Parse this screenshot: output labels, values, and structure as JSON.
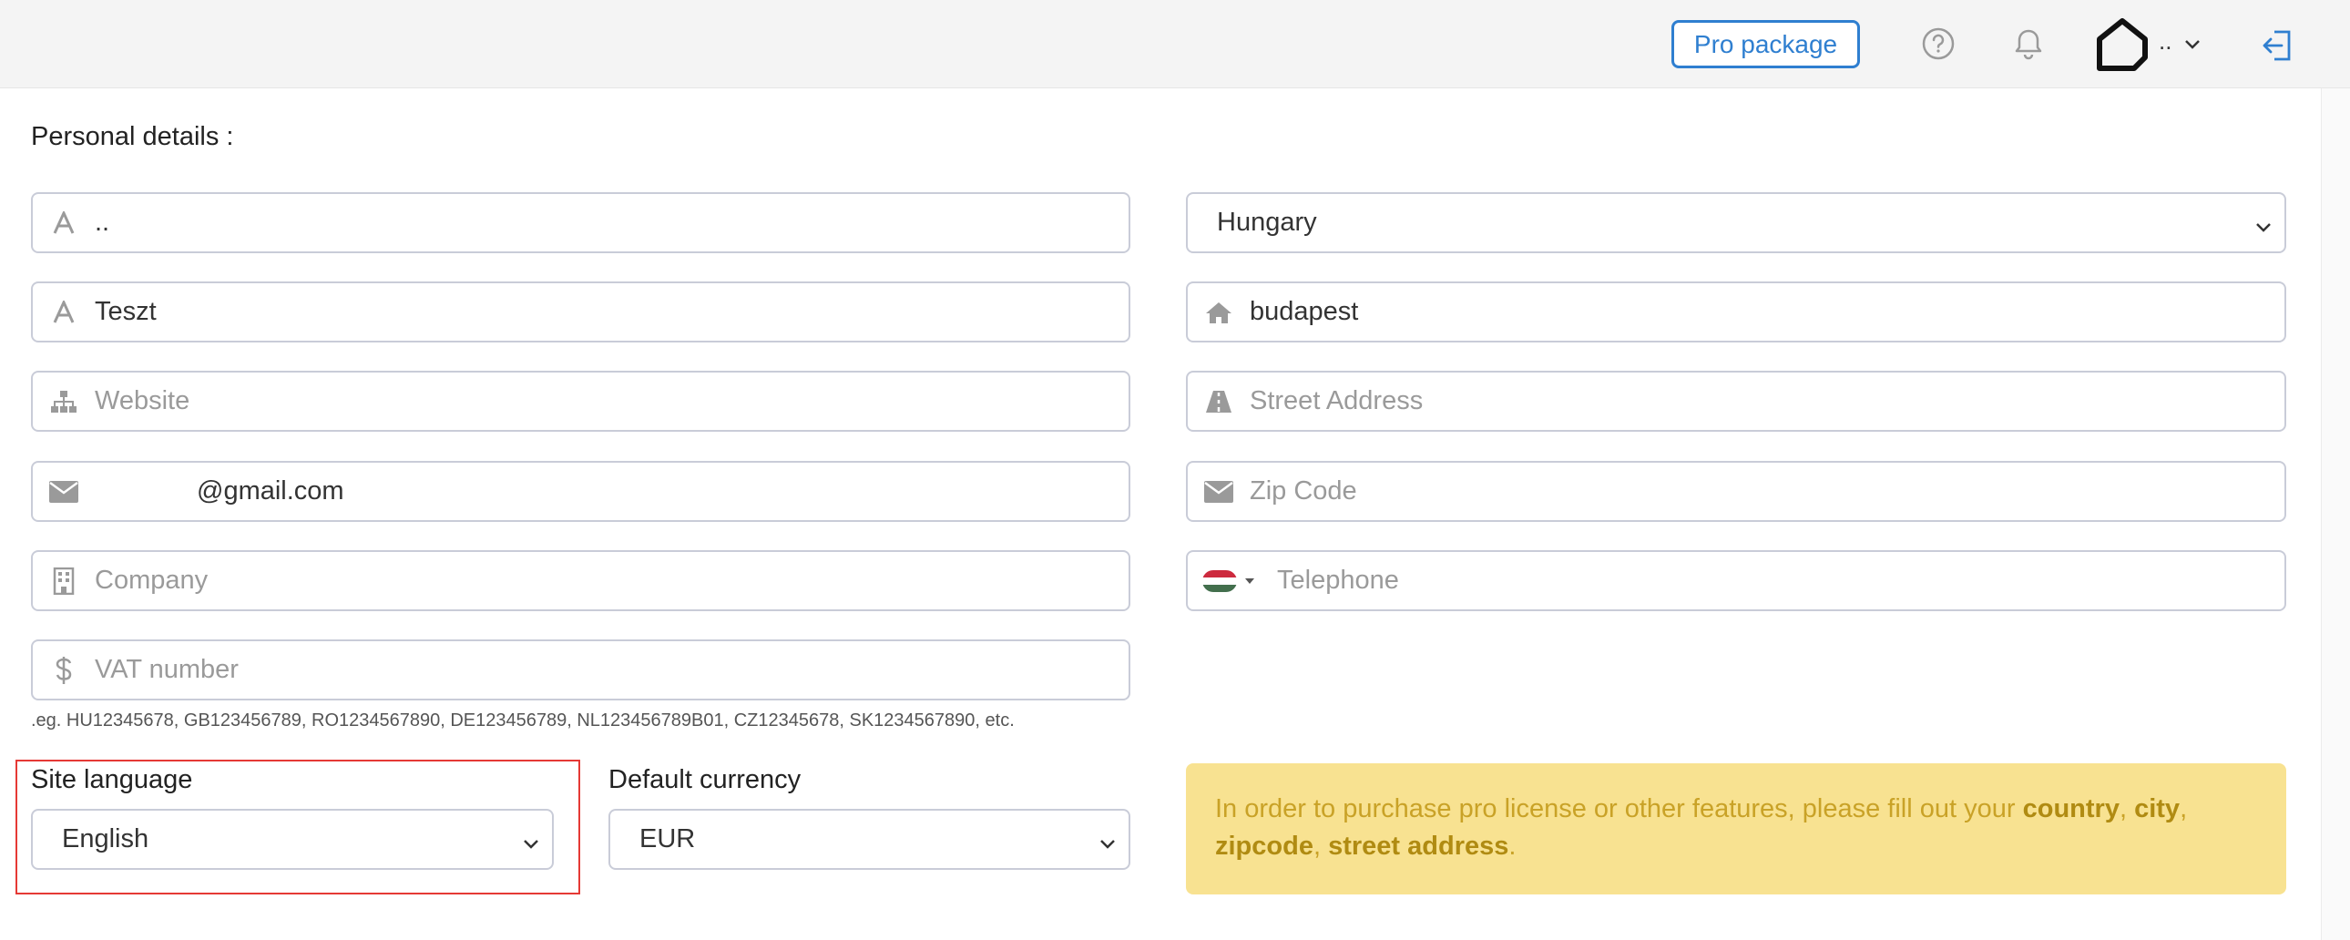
{
  "header": {
    "pro_package_label": "Pro package",
    "user_name": ".."
  },
  "personal_details": {
    "title": "Personal details :",
    "last_name": "..",
    "first_name": "Teszt",
    "website_placeholder": "Website",
    "email": "@gmail.com",
    "company_placeholder": "Company",
    "vat_placeholder": "VAT number",
    "vat_hint": ".eg. HU12345678, GB123456789, RO1234567890, DE123456789, NL123456789B01, CZ12345678, SK1234567890, etc.",
    "country": "Hungary",
    "city": "budapest",
    "street_placeholder": "Street Address",
    "zip_placeholder": "Zip Code",
    "telephone_placeholder": "Telephone"
  },
  "settings": {
    "site_language_label": "Site language",
    "site_language_value": "English",
    "currency_label": "Default currency",
    "currency_value": "EUR"
  },
  "notice": {
    "text_before": "In order to purchase pro license or other features, please fill out your ",
    "country": "country",
    "sep1": ", ",
    "city": "city",
    "sep2": ",",
    "zipcode": "zipcode",
    "sep3": ", ",
    "street_address": "street address",
    "end": "."
  },
  "colors": {
    "accent": "#2f7fd0",
    "notice_bg": "#f8e291",
    "notice_text": "#c9a227",
    "highlight_border": "#e53935",
    "flag": [
      "#cd2a3e",
      "#ffffff",
      "#436f4d"
    ]
  }
}
